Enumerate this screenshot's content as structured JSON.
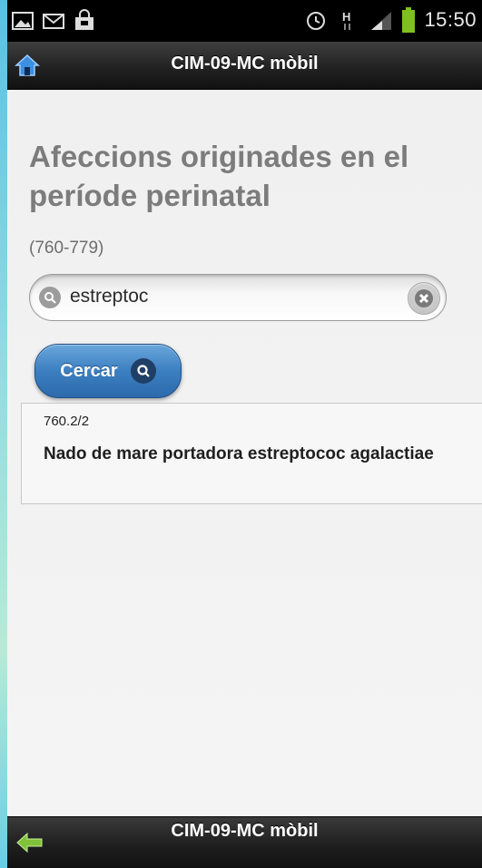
{
  "status_bar": {
    "time": "15:50",
    "left_icons": [
      "image-icon",
      "mail-icon",
      "shopping-bag-icon"
    ],
    "right_icons": [
      "alarm-icon",
      "data-signal-icon",
      "signal-strength-icon",
      "battery-icon"
    ]
  },
  "header": {
    "title": "CIM-09-MC mòbil",
    "home_icon": "home-icon"
  },
  "main": {
    "title": "Afeccions originades en el període perinatal",
    "code_range": "(760-779)",
    "search": {
      "value": "estreptoc",
      "placeholder": ""
    },
    "search_button_label": "Cercar",
    "results": [
      {
        "code": "760.2/2",
        "description": "Nado de mare portadora estreptococ agalactiae"
      }
    ]
  },
  "footer": {
    "title": "CIM-09-MC mòbil",
    "back_icon": "back-arrow-icon"
  },
  "colors": {
    "header_bg": "#222222",
    "button_blue": "#3c7fc0",
    "title_gray": "#7c7c7c",
    "battery_green": "#7ec020"
  }
}
